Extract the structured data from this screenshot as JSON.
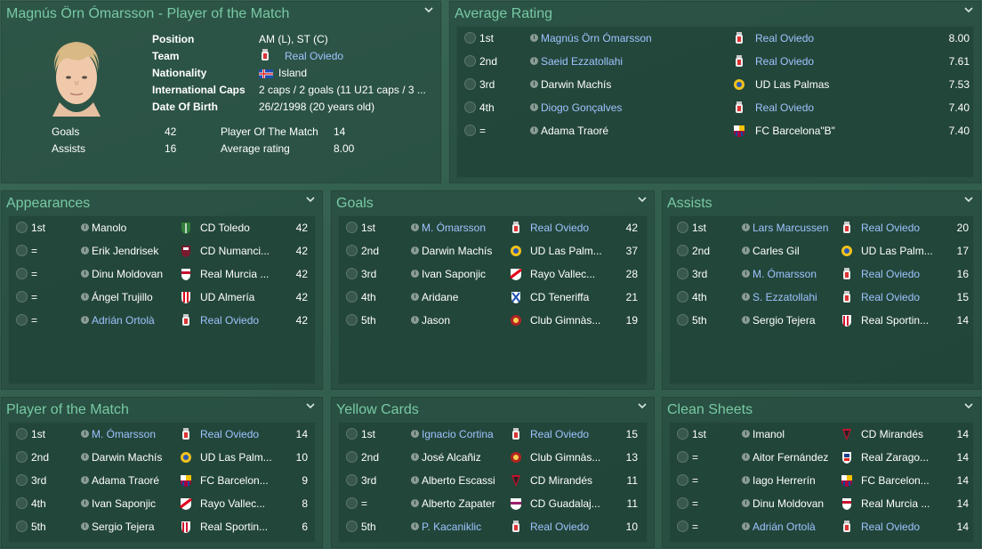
{
  "profile": {
    "title": "Magnús Örn Ómarsson - Player of the Match",
    "fields": [
      {
        "label": "Position",
        "value": "AM (L), ST (C)"
      },
      {
        "label": "Team",
        "value": "Real Oviedo"
      },
      {
        "label": "Nationality",
        "value": "Island"
      },
      {
        "label": "International Caps",
        "value": "2 caps / 2 goals (11 U21 caps / 3 ..."
      },
      {
        "label": "Date Of Birth",
        "value": "26/2/1998 (20 years old)"
      }
    ],
    "stats": {
      "goals_label": "Goals",
      "goals": "42",
      "assists_label": "Assists",
      "assists": "16",
      "potm_label": "Player Of The Match",
      "potm": "14",
      "avg_label": "Average rating",
      "avg": "8.00"
    }
  },
  "colors": {
    "title": "#78c9a4",
    "link": "#9fc3ff",
    "text": "#ffffff"
  },
  "average_rating": {
    "title": "Average Rating",
    "rows": [
      {
        "rank": "1st",
        "player": "Magnús Örn Ómarsson",
        "player_link": true,
        "club": "Real Oviedo",
        "club_link": true,
        "crest": "oviedo",
        "value": "8.00"
      },
      {
        "rank": "2nd",
        "player": "Saeid Ezzatollahi",
        "player_link": true,
        "club": "Real Oviedo",
        "club_link": true,
        "crest": "oviedo",
        "value": "7.61"
      },
      {
        "rank": "3rd",
        "player": "Darwin Machís",
        "player_link": false,
        "club": "UD Las Palmas",
        "club_link": false,
        "crest": "laspalmas",
        "value": "7.53"
      },
      {
        "rank": "4th",
        "player": "Diogo Gonçalves",
        "player_link": true,
        "club": "Real Oviedo",
        "club_link": true,
        "crest": "oviedo",
        "value": "7.40"
      },
      {
        "rank": "=",
        "player": "Adama Traoré",
        "player_link": false,
        "club": "FC Barcelona\"B\"",
        "club_link": false,
        "crest": "barcelona",
        "value": "7.40"
      }
    ]
  },
  "appearances": {
    "title": "Appearances",
    "rows": [
      {
        "rank": "1st",
        "player": "Manolo",
        "player_link": false,
        "club": "CD Toledo",
        "club_link": false,
        "crest": "toledo",
        "value": "42"
      },
      {
        "rank": "=",
        "player": "Erik Jendrisek",
        "player_link": false,
        "club": "CD Numanci...",
        "club_link": false,
        "crest": "numancia",
        "value": "42"
      },
      {
        "rank": "=",
        "player": "Dinu Moldovan",
        "player_link": false,
        "club": "Real Murcia ...",
        "club_link": false,
        "crest": "murcia",
        "value": "42"
      },
      {
        "rank": "=",
        "player": "Ángel Trujillo",
        "player_link": false,
        "club": "UD Almería",
        "club_link": false,
        "crest": "almeria",
        "value": "42"
      },
      {
        "rank": "=",
        "player": "Adrián Ortolà",
        "player_link": true,
        "club": "Real Oviedo",
        "club_link": true,
        "crest": "oviedo",
        "value": "42"
      }
    ]
  },
  "goals": {
    "title": "Goals",
    "rows": [
      {
        "rank": "1st",
        "player": "M. Ómarsson",
        "player_link": true,
        "club": "Real Oviedo",
        "club_link": true,
        "crest": "oviedo",
        "value": "42"
      },
      {
        "rank": "2nd",
        "player": "Darwin Machís",
        "player_link": false,
        "club": "UD Las Palm...",
        "club_link": false,
        "crest": "laspalmas",
        "value": "37"
      },
      {
        "rank": "3rd",
        "player": "Ivan Saponjic",
        "player_link": false,
        "club": "Rayo Vallec...",
        "club_link": false,
        "crest": "rayo",
        "value": "28"
      },
      {
        "rank": "4th",
        "player": "Aridane",
        "player_link": false,
        "club": "CD Teneriffa",
        "club_link": false,
        "crest": "tenerife",
        "value": "21"
      },
      {
        "rank": "5th",
        "player": "Jason",
        "player_link": false,
        "club": "Club Gimnàs...",
        "club_link": false,
        "crest": "gimnastic",
        "value": "19"
      }
    ]
  },
  "assists": {
    "title": "Assists",
    "rows": [
      {
        "rank": "1st",
        "player": "Lars Marcussen",
        "player_link": true,
        "club": "Real Oviedo",
        "club_link": true,
        "crest": "oviedo",
        "value": "20"
      },
      {
        "rank": "2nd",
        "player": "Carles Gil",
        "player_link": false,
        "club": "UD Las Palm...",
        "club_link": false,
        "crest": "laspalmas",
        "value": "17"
      },
      {
        "rank": "3rd",
        "player": "M. Ómarsson",
        "player_link": true,
        "club": "Real Oviedo",
        "club_link": true,
        "crest": "oviedo",
        "value": "16"
      },
      {
        "rank": "4th",
        "player": "S. Ezzatollahi",
        "player_link": true,
        "club": "Real Oviedo",
        "club_link": true,
        "crest": "oviedo",
        "value": "15"
      },
      {
        "rank": "5th",
        "player": "Sergio Tejera",
        "player_link": false,
        "club": "Real Sportin...",
        "club_link": false,
        "crest": "sporting",
        "value": "14"
      }
    ]
  },
  "potm": {
    "title": "Player of the Match",
    "rows": [
      {
        "rank": "1st",
        "player": "M. Ómarsson",
        "player_link": true,
        "club": "Real Oviedo",
        "club_link": true,
        "crest": "oviedo",
        "value": "14"
      },
      {
        "rank": "2nd",
        "player": "Darwin Machís",
        "player_link": false,
        "club": "UD Las Palm...",
        "club_link": false,
        "crest": "laspalmas",
        "value": "10"
      },
      {
        "rank": "3rd",
        "player": "Adama Traoré",
        "player_link": false,
        "club": "FC Barcelon...",
        "club_link": false,
        "crest": "barcelona",
        "value": "9"
      },
      {
        "rank": "4th",
        "player": "Ivan Saponjic",
        "player_link": false,
        "club": "Rayo Vallec...",
        "club_link": false,
        "crest": "rayo",
        "value": "8"
      },
      {
        "rank": "5th",
        "player": "Sergio Tejera",
        "player_link": false,
        "club": "Real Sportin...",
        "club_link": false,
        "crest": "sporting",
        "value": "6"
      }
    ]
  },
  "yellow": {
    "title": "Yellow Cards",
    "rows": [
      {
        "rank": "1st",
        "player": "Ignacio Cortina",
        "player_link": true,
        "club": "Real Oviedo",
        "club_link": true,
        "crest": "oviedo",
        "value": "15"
      },
      {
        "rank": "2nd",
        "player": "José Alcañiz",
        "player_link": false,
        "club": "Club Gimnàs...",
        "club_link": false,
        "crest": "gimnastic",
        "value": "13"
      },
      {
        "rank": "3rd",
        "player": "Alberto Escassi",
        "player_link": false,
        "club": "CD Mirandés",
        "club_link": false,
        "crest": "mirandes",
        "value": "11"
      },
      {
        "rank": "=",
        "player": "Alberto Zapater",
        "player_link": false,
        "club": "CD Guadalaj...",
        "club_link": false,
        "crest": "guadalajara",
        "value": "11"
      },
      {
        "rank": "5th",
        "player": "P. Kacaniklic",
        "player_link": true,
        "club": "Real Oviedo",
        "club_link": true,
        "crest": "oviedo",
        "value": "10"
      }
    ]
  },
  "clean": {
    "title": "Clean Sheets",
    "rows": [
      {
        "rank": "1st",
        "player": "Imanol",
        "player_link": false,
        "club": "CD Mirandés",
        "club_link": false,
        "crest": "mirandes",
        "value": "14"
      },
      {
        "rank": "=",
        "player": "Aitor Fernández",
        "player_link": false,
        "club": "Real Zarago...",
        "club_link": false,
        "crest": "zaragoza",
        "value": "14"
      },
      {
        "rank": "=",
        "player": "Iago Herrerín",
        "player_link": false,
        "club": "FC Barcelon...",
        "club_link": false,
        "crest": "barcelona",
        "value": "14"
      },
      {
        "rank": "=",
        "player": "Dinu Moldovan",
        "player_link": false,
        "club": "Real Murcia ...",
        "club_link": false,
        "crest": "murcia",
        "value": "14"
      },
      {
        "rank": "=",
        "player": "Adrián Ortolà",
        "player_link": true,
        "club": "Real Oviedo",
        "club_link": true,
        "crest": "oviedo",
        "value": "14"
      }
    ]
  }
}
